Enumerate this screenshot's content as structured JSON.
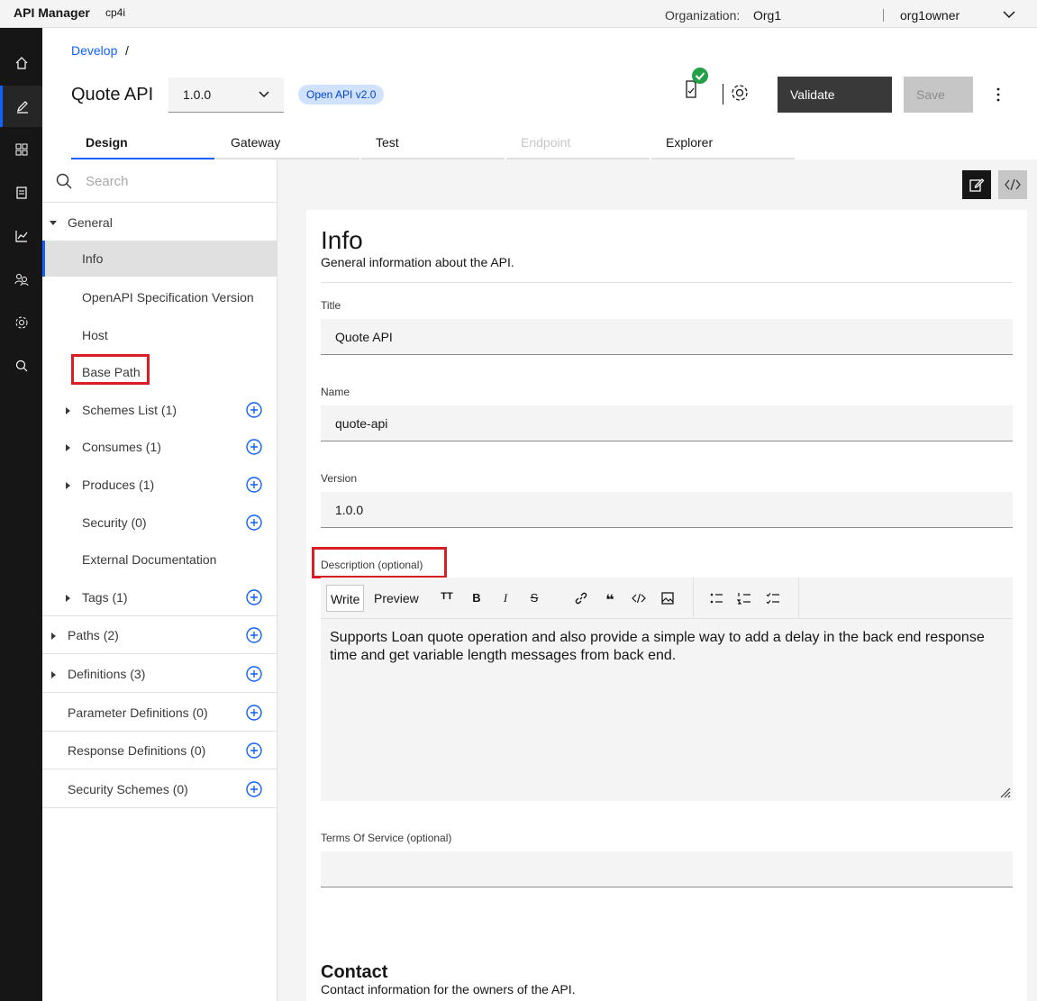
{
  "topbar": {
    "brand": "API Manager",
    "brand_sub": "cp4i",
    "org_label": "Organization:",
    "org_value": "Org1",
    "user": "org1owner"
  },
  "rail": {
    "items": [
      "home-icon",
      "edit-icon",
      "apps-icon",
      "catalog-icon",
      "analytics-icon",
      "members-icon",
      "settings-icon",
      "search-icon"
    ]
  },
  "breadcrumb": {
    "develop": "Develop",
    "separator": "/"
  },
  "header": {
    "title": "Quote API",
    "version": "1.0.0",
    "spec_tag": "Open API v2.0",
    "validate_label": "Validate",
    "save_label": "Save"
  },
  "tabs": [
    {
      "label": "Design",
      "state": "active"
    },
    {
      "label": "Gateway",
      "state": "normal"
    },
    {
      "label": "Test",
      "state": "normal"
    },
    {
      "label": "Endpoint",
      "state": "disabled"
    },
    {
      "label": "Explorer",
      "state": "normal"
    }
  ],
  "nav": {
    "search_placeholder": "Search",
    "general": "General",
    "info": "Info",
    "openapi_version": "OpenAPI Specification Version",
    "host": "Host",
    "base_path": "Base Path",
    "schemes": "Schemes List (1)",
    "consumes": "Consumes (1)",
    "produces": "Produces (1)",
    "security": "Security (0)",
    "external_docs": "External Documentation",
    "tags": "Tags (1)",
    "paths": "Paths (2)",
    "definitions": "Definitions (3)",
    "parameter_definitions": "Parameter Definitions (0)",
    "response_definitions": "Response Definitions (0)",
    "security_schemes": "Security Schemes (0)"
  },
  "form": {
    "heading": "Info",
    "subheading": "General information about the API.",
    "title_label": "Title",
    "title_value": "Quote API",
    "name_label": "Name",
    "name_value": "quote-api",
    "version_label": "Version",
    "version_value": "1.0.0",
    "description_label": "Description (optional)",
    "write_tab": "Write",
    "preview_tab": "Preview",
    "description_value": "Supports Loan quote operation and also provide a simple way to add a delay in the back end response time and get variable length messages from back end.",
    "tos_label": "Terms Of Service (optional)",
    "tos_value": "",
    "contact_heading": "Contact",
    "contact_subheading": "Contact information for the owners of the API."
  },
  "toolbar_icons": [
    "heading-icon",
    "bold-icon",
    "italic-icon",
    "strikethrough-icon",
    "link-icon",
    "quote-icon",
    "code-icon",
    "image-icon",
    "bullet-list-icon",
    "numbered-list-icon",
    "task-list-icon"
  ],
  "colors": {
    "accent": "#0f62fe",
    "highlight": "#da1e28",
    "success": "#24a148",
    "rail_bg": "#161616"
  }
}
